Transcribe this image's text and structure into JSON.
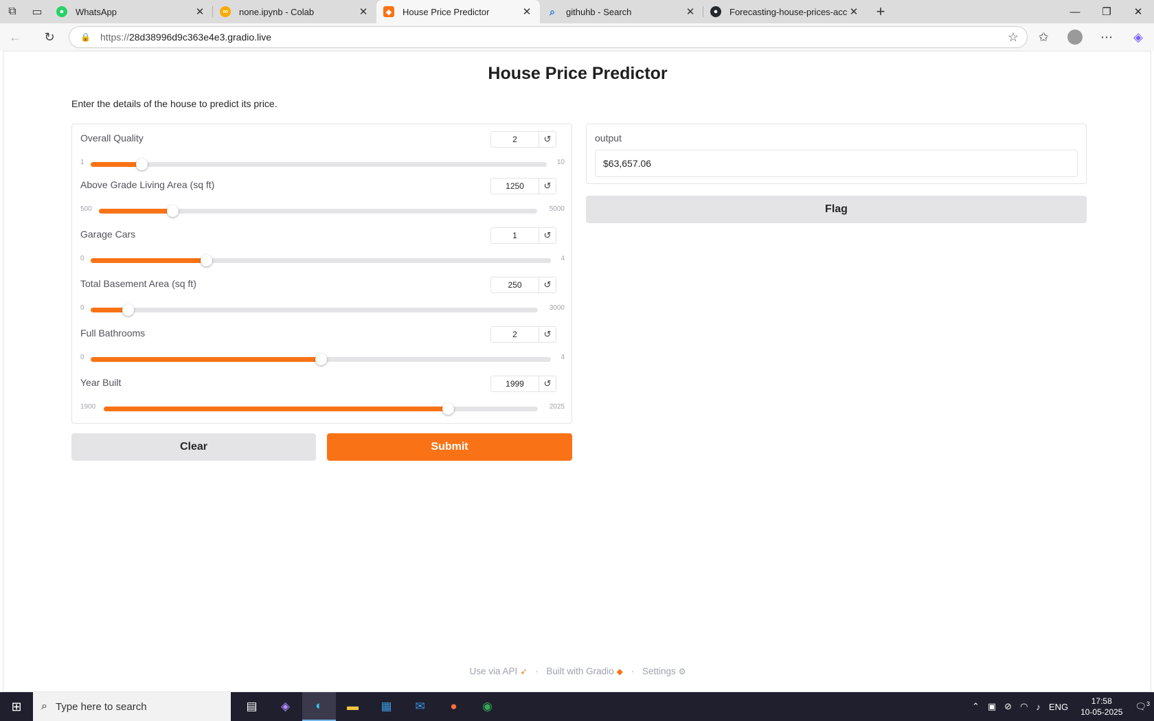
{
  "browser": {
    "tabs": [
      {
        "title": "WhatsApp",
        "icon": "whatsapp-icon",
        "color": "#25d366"
      },
      {
        "title": "none.ipynb - Colab",
        "icon": "colab-icon",
        "color": "#f9ab00"
      },
      {
        "title": "House Price Predictor",
        "icon": "gradio-icon",
        "color": "#f97316"
      },
      {
        "title": "githuhb - Search",
        "icon": "search-icon",
        "color": "#1a73e8"
      },
      {
        "title": "Forecasting-house-prices-accurat",
        "icon": "github-icon",
        "color": "#24292f"
      }
    ],
    "url_scheme": "https://",
    "url_host": "28d38996d9c363e4e3.gradio.live"
  },
  "app": {
    "title": "House Price Predictor",
    "description": "Enter the details of the house to predict its price.",
    "sliders": [
      {
        "label": "Overall Quality",
        "value": "2",
        "min": "1",
        "max": "10",
        "fraction": 0.111
      },
      {
        "label": "Above Grade Living Area (sq ft)",
        "value": "1250",
        "min": "500",
        "max": "5000",
        "fraction": 0.167
      },
      {
        "label": "Garage Cars",
        "value": "1",
        "min": "0",
        "max": "4",
        "fraction": 0.25
      },
      {
        "label": "Total Basement Area (sq ft)",
        "value": "250",
        "min": "0",
        "max": "3000",
        "fraction": 0.083
      },
      {
        "label": "Full Bathrooms",
        "value": "2",
        "min": "0",
        "max": "4",
        "fraction": 0.5
      },
      {
        "label": "Year Built",
        "value": "1999",
        "min": "1900",
        "max": "2025",
        "fraction": 0.792
      }
    ],
    "output_label": "output",
    "output_value": "$63,657.06",
    "flag_label": "Flag",
    "clear_label": "Clear",
    "submit_label": "Submit",
    "accent_color": "#f97316"
  },
  "footer": {
    "api": "Use via API",
    "built": "Built with Gradio",
    "settings": "Settings"
  },
  "taskbar": {
    "search_placeholder": "Type here to search",
    "language": "ENG",
    "time": "17:58",
    "date": "10-05-2025",
    "notifications": "3"
  }
}
